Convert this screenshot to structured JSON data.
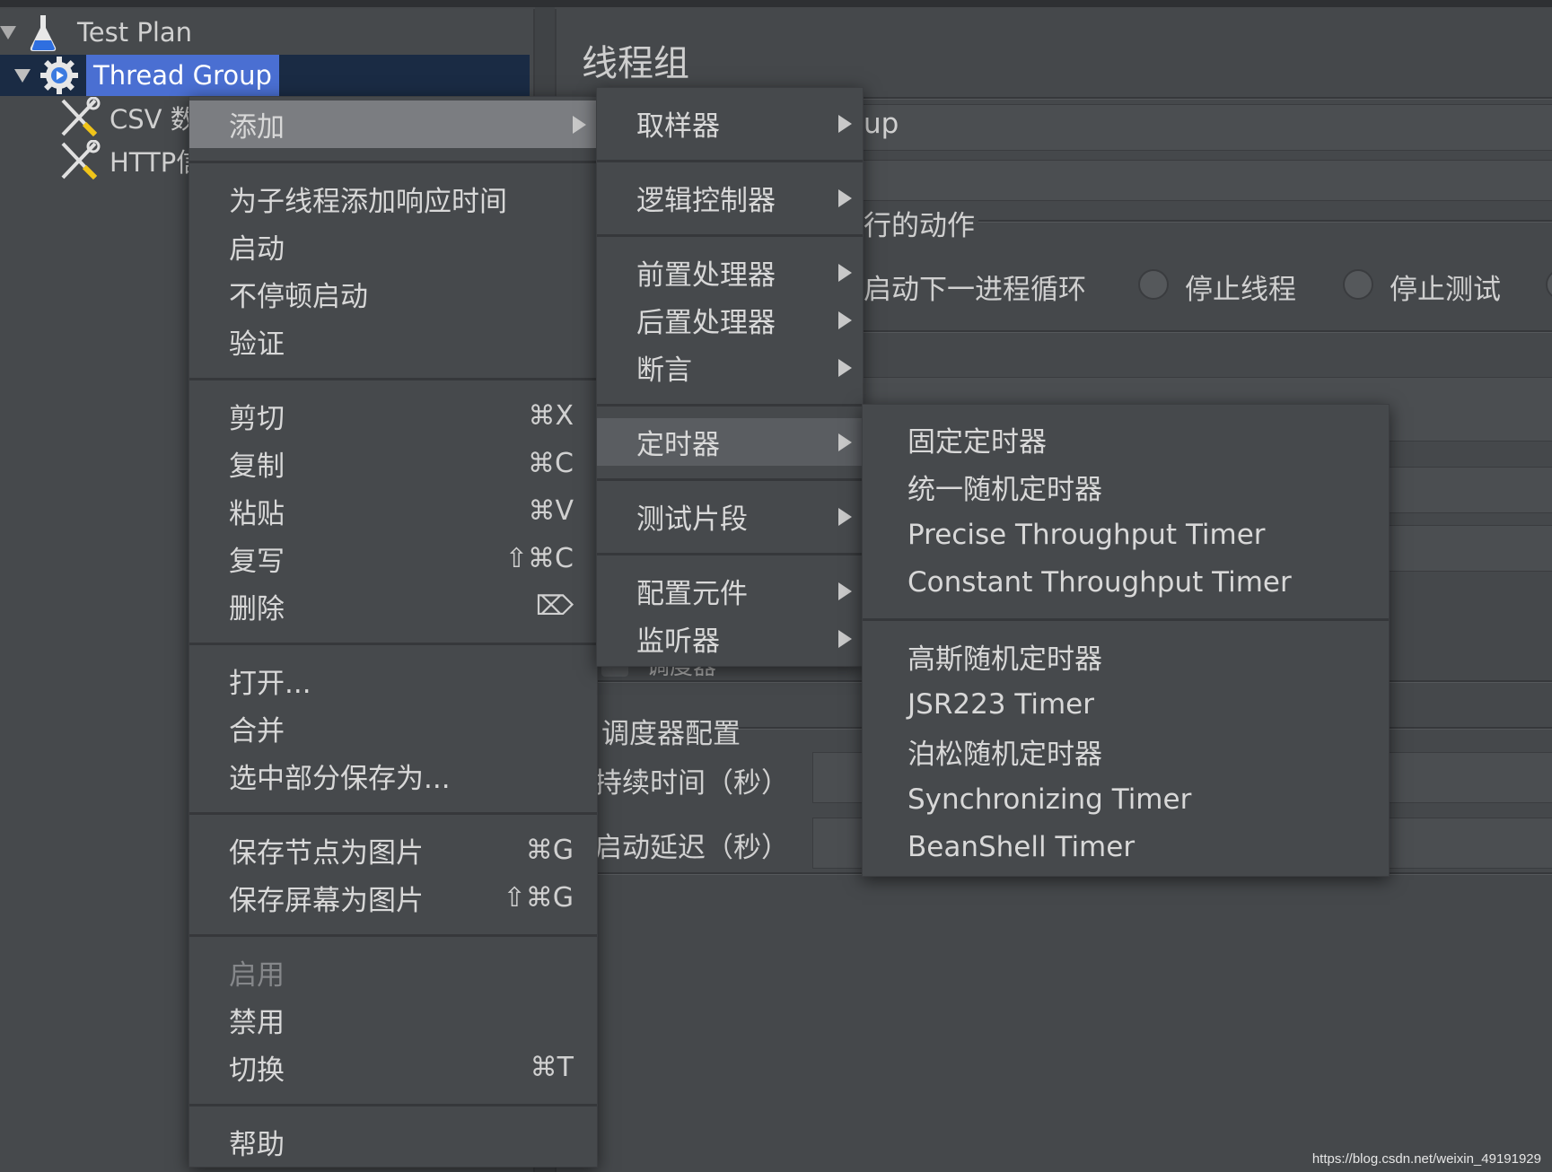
{
  "tree": {
    "items": [
      {
        "label": "Test Plan",
        "icon": "flask-icon"
      },
      {
        "label": "Thread Group",
        "icon": "gear-icon",
        "selected": true
      },
      {
        "label": "CSV 数据文件设置",
        "icon": "wrench-screwdriver-icon"
      },
      {
        "label": "HTTP信息头管理器",
        "icon": "wrench-screwdriver-icon"
      }
    ]
  },
  "panel": {
    "title": "线程组",
    "name_value_fragment": "up",
    "error_action_legend_fragment": "行的动作",
    "error_actions": [
      "启动下一进程循环",
      "停止线程",
      "停止测试"
    ],
    "scheduler_checkbox_label": "调度器",
    "scheduler_legend": "调度器配置",
    "duration_label": "持续时间（秒）",
    "startup_delay_label": "启动延迟（秒）"
  },
  "context_menu": {
    "items": [
      {
        "label": "添加",
        "submenu": true,
        "highlighted": true
      },
      {
        "sep": true
      },
      {
        "label": "为子线程添加响应时间"
      },
      {
        "label": "启动"
      },
      {
        "label": "不停顿启动"
      },
      {
        "label": "验证"
      },
      {
        "sep": true
      },
      {
        "label": "剪切",
        "shortcut": "⌘X"
      },
      {
        "label": "复制",
        "shortcut": "⌘C"
      },
      {
        "label": "粘贴",
        "shortcut": "⌘V"
      },
      {
        "label": "复写",
        "shortcut": "⇧⌘C"
      },
      {
        "label": "删除",
        "shortcut": "⌦"
      },
      {
        "sep": true
      },
      {
        "label": "打开..."
      },
      {
        "label": "合并"
      },
      {
        "label": "选中部分保存为..."
      },
      {
        "sep": true
      },
      {
        "label": "保存节点为图片",
        "shortcut": "⌘G"
      },
      {
        "label": "保存屏幕为图片",
        "shortcut": "⇧⌘G"
      },
      {
        "sep": true
      },
      {
        "label": "启用",
        "disabled": true
      },
      {
        "label": "禁用"
      },
      {
        "label": "切换",
        "shortcut": "⌘T"
      },
      {
        "sep": true
      },
      {
        "label": "帮助"
      }
    ]
  },
  "add_submenu": {
    "items": [
      {
        "label": "取样器",
        "submenu": true
      },
      {
        "sep": true
      },
      {
        "label": "逻辑控制器",
        "submenu": true
      },
      {
        "sep": true
      },
      {
        "label": "前置处理器",
        "submenu": true
      },
      {
        "label": "后置处理器",
        "submenu": true
      },
      {
        "label": "断言",
        "submenu": true
      },
      {
        "sep": true
      },
      {
        "label": "定时器",
        "submenu": true,
        "highlighted": true
      },
      {
        "sep": true
      },
      {
        "label": "测试片段",
        "submenu": true
      },
      {
        "sep": true
      },
      {
        "label": "配置元件",
        "submenu": true
      },
      {
        "label": "监听器",
        "submenu": true
      }
    ]
  },
  "timer_submenu": {
    "items": [
      {
        "label": "固定定时器"
      },
      {
        "label": "统一随机定时器"
      },
      {
        "label": "Precise Throughput Timer"
      },
      {
        "label": "Constant Throughput Timer"
      },
      {
        "sep": true
      },
      {
        "label": "高斯随机定时器"
      },
      {
        "label": "JSR223 Timer"
      },
      {
        "label": "泊松随机定时器"
      },
      {
        "label": "Synchronizing Timer"
      },
      {
        "label": "BeanShell Timer"
      }
    ]
  },
  "watermark": "https://blog.csdn.net/weixin_49191929",
  "colors": {
    "background": "#45484b",
    "selection": "#4a6fd2",
    "selected_row": "#1a2b44",
    "menu_highlight": "#7b7d81",
    "text": "#d8d8d8"
  }
}
